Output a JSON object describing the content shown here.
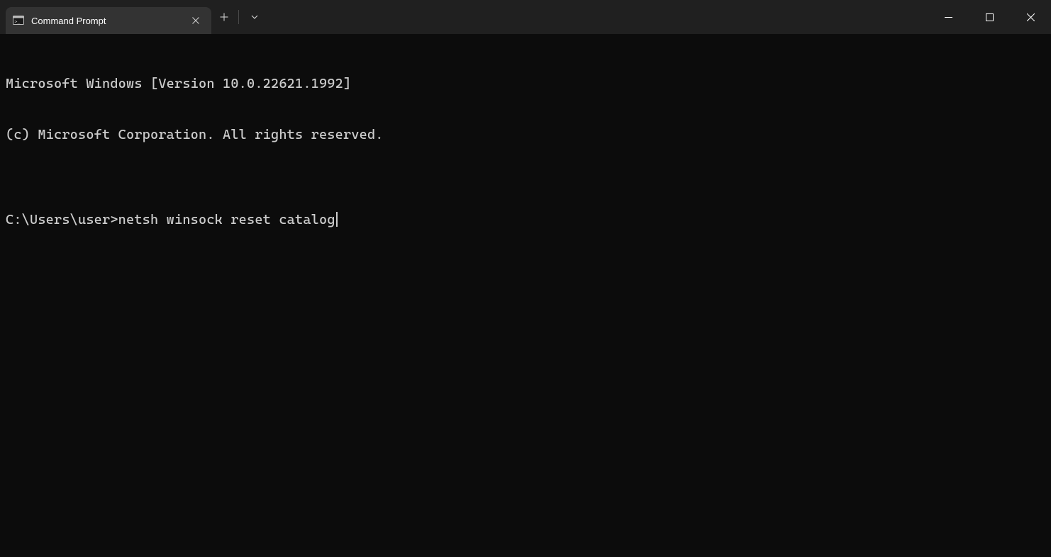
{
  "titlebar": {
    "tab": {
      "title": "Command Prompt"
    }
  },
  "terminal": {
    "line1": "Microsoft Windows [Version 10.0.22621.1992]",
    "line2": "(c) Microsoft Corporation. All rights reserved.",
    "blank": "",
    "prompt": "C:\\Users\\user>",
    "command": "netsh winsock reset catalog"
  }
}
